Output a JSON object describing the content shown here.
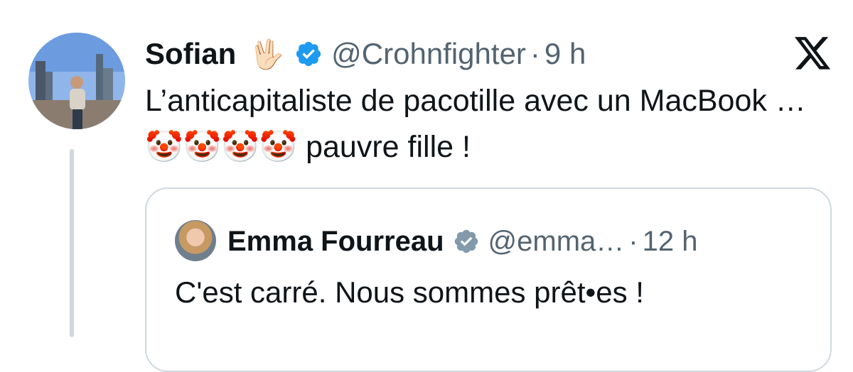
{
  "tweet": {
    "author_name": "Sofian",
    "author_emoji": "🖖🏻",
    "handle": "@Crohnfighter",
    "separator": "·",
    "time": "9 h",
    "text": "L’anticapitaliste de pacotille avec un MacBook … 🤡🤡🤡🤡 pauvre fille !",
    "verified_color": "#1d9bf0"
  },
  "quoted_tweet": {
    "author_name": "Emma Fourreau",
    "handle": "@emma…",
    "separator": "·",
    "time": "12 h",
    "text": "C'est carré. Nous sommes prêt•es !",
    "verified_color": "#829aab"
  },
  "icons": {
    "platform_logo": "x-logo-icon",
    "verified": "verified-badge-icon"
  },
  "colors": {
    "text_primary": "#0f1419",
    "text_secondary": "#536471",
    "border": "#cfd9de"
  }
}
